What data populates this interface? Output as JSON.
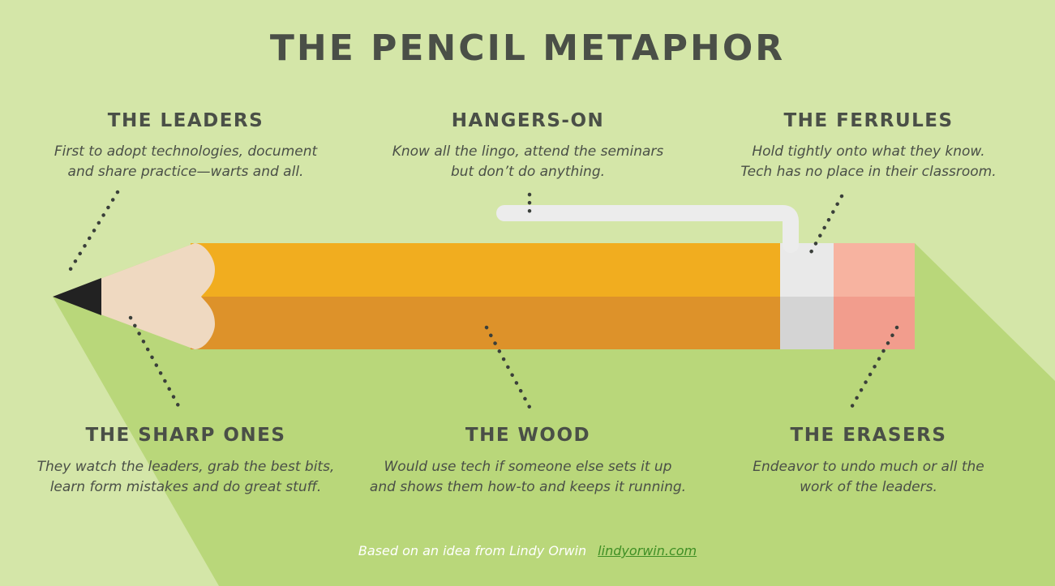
{
  "title": "THE PENCIL METAPHOR",
  "sections": {
    "leaders": {
      "heading": "THE LEADERS",
      "line1": "First to adopt technologies, document",
      "line2": "and share practice—warts and all."
    },
    "hangers_on": {
      "heading": "HANGERS-ON",
      "line1": "Know all the lingo, attend the seminars",
      "line2": "but don’t do anything."
    },
    "ferrules": {
      "heading": "THE FERRULES",
      "line1": "Hold tightly onto what they know.",
      "line2": "Tech has no place in their classroom."
    },
    "sharp_ones": {
      "heading": "THE SHARP ONES",
      "line1": "They watch the leaders, grab the best bits,",
      "line2": "learn form mistakes and do great stuff."
    },
    "wood": {
      "heading": "THE WOOD",
      "line1": "Would use tech if someone else sets it up",
      "line2": "and shows them how-to and keeps it running."
    },
    "erasers": {
      "heading": "THE ERASERS",
      "line1": "Endeavor to undo much or all the",
      "line2": "work of the leaders."
    }
  },
  "credit": {
    "text": "Based on an idea from Lindy Orwin",
    "link": "lindyorwin.com"
  },
  "colors": {
    "background": "#d4e6a8",
    "shadow": "#b9d77a",
    "wood_light": "#f1ad1f",
    "wood_dark": "#dd922a",
    "tip_wood": "#efd9c1",
    "lead": "#222222",
    "ferrule_light": "#e9e9e9",
    "ferrule_dark": "#d4d4d4",
    "eraser_light": "#f7b3a0",
    "eraser_dark": "#f29d8d",
    "text": "#4a4f47",
    "dots": "#3a3f3a",
    "link": "#3f8f25"
  },
  "icons": [
    "pencil-illustration",
    "pencil-clip",
    "dotted-pointer"
  ]
}
